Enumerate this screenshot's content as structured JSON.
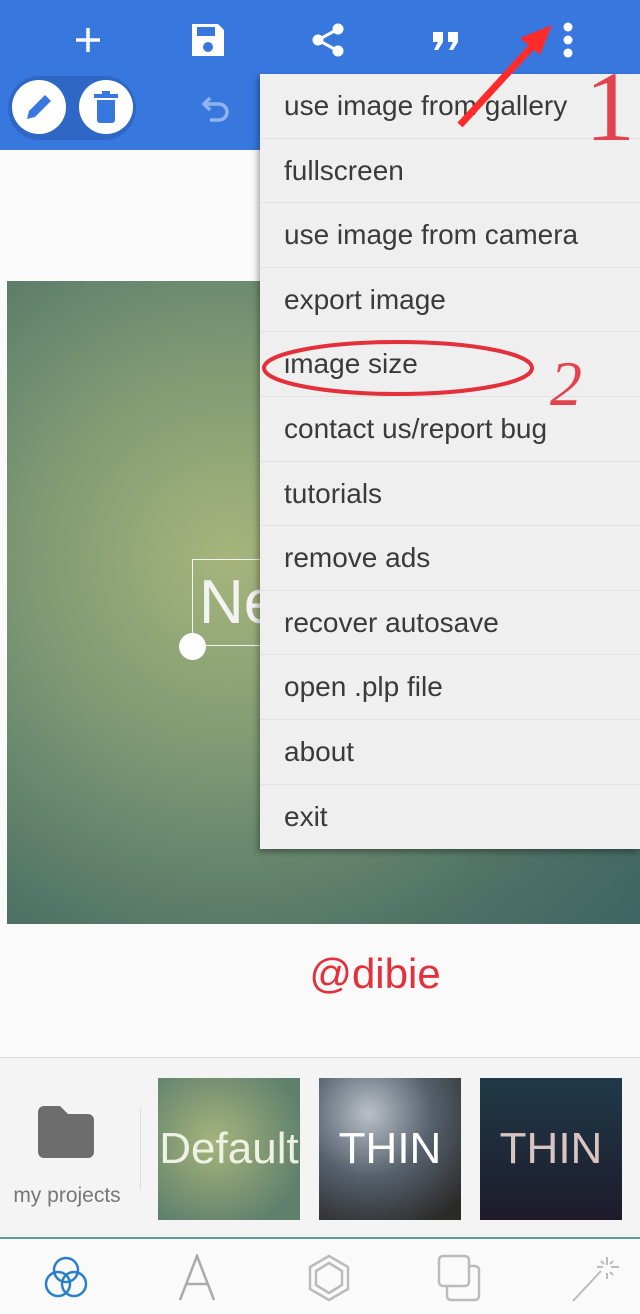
{
  "toolbar": {
    "icons": [
      "plus-icon",
      "save-icon",
      "share-icon",
      "quote-icon",
      "more-vert-icon"
    ],
    "tools": [
      "pencil-icon",
      "trash-icon",
      "undo-icon"
    ]
  },
  "canvas": {
    "text": "Ne"
  },
  "menu": {
    "items": [
      "use image from gallery",
      "fullscreen",
      "use image from camera",
      "export image",
      "image size",
      "contact us/report bug",
      "tutorials",
      "remove ads",
      "recover autosave",
      "open .plp file",
      "about",
      "exit"
    ]
  },
  "annotations": {
    "step1": "1",
    "step2": "2",
    "highlighted_item": "image size",
    "color": "#e3303b"
  },
  "watermark": "@dibie",
  "templates": {
    "my_projects": "my projects",
    "items": [
      "Default",
      "THIN",
      "THIN"
    ]
  },
  "bottom_nav": {
    "active": "blend-icon",
    "icons": [
      "blend-icon",
      "text-icon",
      "shape-icon",
      "layers-icon",
      "magic-wand-icon"
    ]
  },
  "colors": {
    "primary": "#3877de",
    "menu_bg": "#efefef",
    "accent_nav": "#2a7fc8"
  }
}
